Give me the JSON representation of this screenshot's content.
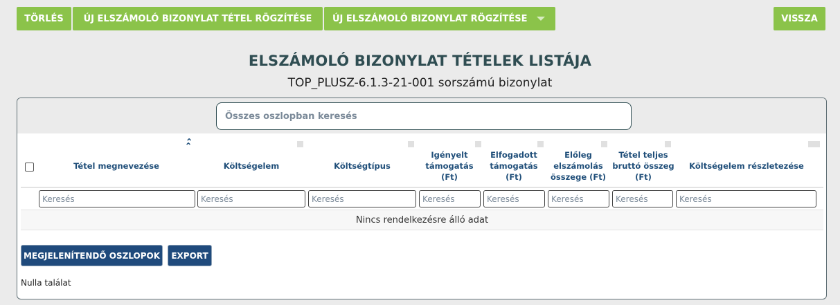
{
  "toolbar": {
    "delete_label": "TÖRLÉS",
    "new_item_label": "ÚJ ELSZÁMOLÓ BIZONYLAT TÉTEL RÖGZÍTÉSE",
    "new_doc_label": "ÚJ ELSZÁMOLÓ BIZONYLAT RÖGZÍTÉSE",
    "back_label": "VISSZA"
  },
  "page": {
    "title": "ELSZÁMOLÓ BIZONYLAT TÉTELEK LISTÁJA",
    "subtitle": "TOP_PLUSZ-6.1.3-21-001 sorszámú bizonylat"
  },
  "grid": {
    "global_search_placeholder": "Összes oszlopban keresés",
    "columns": [
      {
        "label": "Tétel megnevezése",
        "sorted": "ascending"
      },
      {
        "label": "Költségelem"
      },
      {
        "label": "Költségtípus"
      },
      {
        "label": "Igényelt támogatás (Ft)"
      },
      {
        "label": "Elfogadott támogatás (Ft)"
      },
      {
        "label": "Előleg elszámolás összege (Ft)"
      },
      {
        "label": "Tétel teljes bruttó összeg (Ft)"
      },
      {
        "label": "Költségelem részletezése"
      }
    ],
    "filter_placeholder": "Keresés",
    "empty_message": "Nincs rendelkezésre álló adat",
    "columns_button": "MEGJELENÍTENDŐ OSZLOPOK",
    "export_button": "EXPORT",
    "result_count": "Nulla találat"
  },
  "colors": {
    "accent_green": "#8bc34a",
    "primary_blue": "#1f4a7c",
    "title_teal": "#2f4d52"
  },
  "icons": {
    "sort_active": "double-chevron-up-icon",
    "dropdown": "caret-down-icon"
  }
}
